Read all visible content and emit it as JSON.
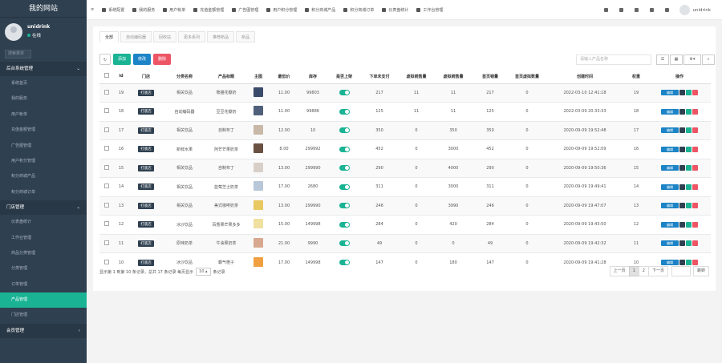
{
  "sidebar": {
    "brand": "我的网站",
    "user": {
      "name": "unidrink",
      "status": "在线"
    },
    "search_placeholder": "搜索菜单",
    "group_main": "后台系统管理",
    "main_items": [
      "系统首页",
      "我的服务",
      "用户帐单",
      "充值金额管理",
      "广告图管理",
      "用户积分管理",
      "积分商城产品",
      "积分商城订单"
    ],
    "group_shop": "门店管理",
    "shop_items": [
      "仪表盘统计",
      "工作台管理",
      "商品分类管理",
      "分类管理",
      "订单管理",
      "产品管理",
      "门店管理"
    ],
    "group_member": "会员管理"
  },
  "topbar": {
    "items": [
      "系统配置",
      "我的服务",
      "用户帐单",
      "充值金额管理",
      "广告图管理",
      "用户积分管理",
      "积分商城产品",
      "积分商城订单",
      "仪表盘统计",
      "工作台管理"
    ],
    "user": "unidrink"
  },
  "tabs": [
    "全部",
    "自动编码器",
    "回收站",
    "更多系列",
    "推荐新品",
    "新品"
  ],
  "toolbar": {
    "add": "添加",
    "edit": "修改",
    "delete": "删除"
  },
  "search_placeholder": "请输入产品名称",
  "table": {
    "headers": [
      "",
      "id",
      "门店",
      "分类名称",
      "产品标题",
      "主图",
      "最低价",
      "库存",
      "是否上架",
      "下单未支付",
      "虚拟销售量",
      "虚拟销售量",
      "首页销量",
      "首页虚拟数量",
      "创建时间",
      "权重",
      "操作"
    ],
    "rows": [
      {
        "id": "19",
        "store": "打底店",
        "cat": "相关饮品",
        "title": "熊猫花瓣奶",
        "price": "11.00",
        "stock": "99803",
        "unpaid": "217",
        "v1": "11",
        "v2": "11",
        "home": "217",
        "homev": "0",
        "time": "2022-03-10 12:41:18",
        "weight": "19"
      },
      {
        "id": "18",
        "store": "打底店",
        "cat": "自动编码器",
        "title": "豆豆花瓣奶",
        "price": "11.00",
        "stock": "99886",
        "unpaid": "125",
        "v1": "11",
        "v2": "11",
        "home": "125",
        "homev": "0",
        "time": "2022-03-09 20:33:33",
        "weight": "18"
      },
      {
        "id": "17",
        "store": "打底店",
        "cat": "相关饮品",
        "title": "自制布丁",
        "price": "12.00",
        "stock": "10",
        "unpaid": "350",
        "v1": "0",
        "v2": "350",
        "home": "350",
        "homev": "0",
        "time": "2020-09-09 19:52:48",
        "weight": "17"
      },
      {
        "id": "16",
        "store": "打底店",
        "cat": "新鲜水果",
        "title": "阿芒芒果奶茶",
        "price": "8.00",
        "stock": "299992",
        "unpaid": "452",
        "v1": "0",
        "v2": "3000",
        "home": "452",
        "homev": "0",
        "time": "2020-09-09 19:52:09",
        "weight": "16"
      },
      {
        "id": "15",
        "store": "打底店",
        "cat": "相关饮品",
        "title": "自制布丁",
        "price": "13.00",
        "stock": "299990",
        "unpaid": "290",
        "v1": "0",
        "v2": "4000",
        "home": "290",
        "homev": "0",
        "time": "2020-09-09 19:50:36",
        "weight": "15"
      },
      {
        "id": "14",
        "store": "打底店",
        "cat": "相关饮品",
        "title": "蓝莓芝士奶茶",
        "price": "17.00",
        "stock": "2680",
        "unpaid": "311",
        "v1": "0",
        "v2": "3000",
        "home": "311",
        "homev": "0",
        "time": "2020-09-09 19:49:41",
        "weight": "14"
      },
      {
        "id": "13",
        "store": "打底店",
        "cat": "相关饮品",
        "title": "美式咖啡奶茶",
        "price": "13.00",
        "stock": "299990",
        "unpaid": "246",
        "v1": "0",
        "v2": "3990",
        "home": "246",
        "homev": "0",
        "time": "2020-09-09 19:47:07",
        "weight": "13"
      },
      {
        "id": "12",
        "store": "打底店",
        "cat": "冰沙饮品",
        "title": "百香果芒果多多",
        "price": "15.00",
        "stock": "149998",
        "unpaid": "284",
        "v1": "0",
        "v2": "420",
        "home": "284",
        "homev": "0",
        "time": "2020-09-09 19:43:50",
        "weight": "12"
      },
      {
        "id": "11",
        "store": "打底店",
        "cat": "原味奶茶",
        "title": "牛油果奶茶",
        "price": "21.00",
        "stock": "9990",
        "unpaid": "49",
        "v1": "0",
        "v2": "0",
        "home": "49",
        "homev": "0",
        "time": "2020-09-09 19:42:32",
        "weight": "11"
      },
      {
        "id": "10",
        "store": "打底店",
        "cat": "冰沙饮品",
        "title": "霸气橙子",
        "price": "17.00",
        "stock": "149998",
        "unpaid": "147",
        "v1": "0",
        "v2": "180",
        "home": "147",
        "homev": "0",
        "time": "2020-09-09 19:41:28",
        "weight": "10"
      }
    ],
    "op_label": "编辑"
  },
  "pagination": {
    "info_pre": "显示第 1 到第 10 条记录，总共 17 条记录 每页显示",
    "per_page": "10",
    "info_post": "条记录",
    "prev": "上一页",
    "pages": [
      "1",
      "2"
    ],
    "next": "下一页",
    "jump": "跳转"
  },
  "colors": {
    "sidebar": "#2f4050",
    "accent": "#1ab394",
    "primary": "#1c84c6",
    "danger": "#ed5565"
  }
}
